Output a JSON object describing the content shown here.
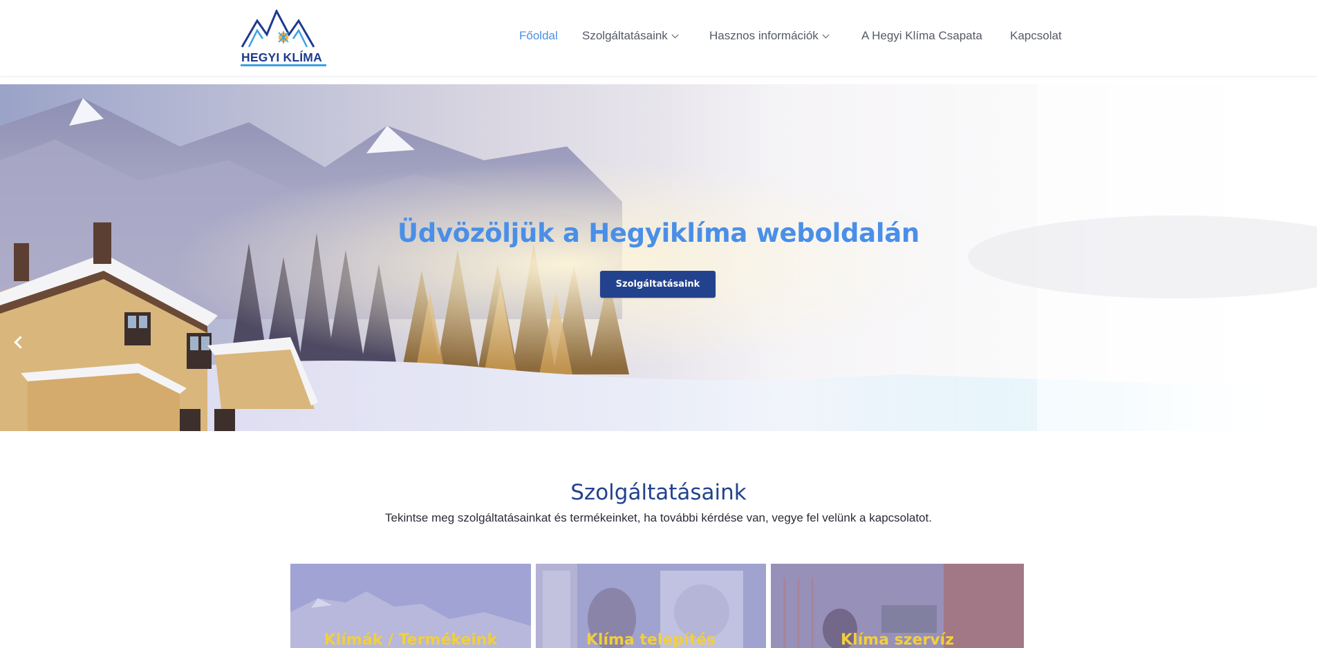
{
  "header": {
    "logo_text": "HEGYI KLÍMA",
    "nav": [
      {
        "label": "Főoldal",
        "active": true,
        "dropdown": false
      },
      {
        "label": "Szolgáltatásaink",
        "active": false,
        "dropdown": true
      },
      {
        "label": "Hasznos információk",
        "active": false,
        "dropdown": true
      },
      {
        "label": "A Hegyi Klíma Csapata",
        "active": false,
        "dropdown": false
      },
      {
        "label": "Kapcsolat",
        "active": false,
        "dropdown": false
      }
    ]
  },
  "hero": {
    "title": "Üdvözöljük a Hegyiklíma weboldalán",
    "button_label": "Szolgáltatásaink",
    "prev_icon": "chevron-left-icon",
    "next_icon": "chevron-right-icon"
  },
  "services": {
    "title": "Szolgáltatásaink",
    "subtitle": "Tekintse meg szolgáltatásainkat és termékeinket, ha további kérdése van, vegye fel velünk a kapcsolatot.",
    "cards": [
      {
        "label": "Klímák / Termékeink"
      },
      {
        "label": "Klíma telepítés"
      },
      {
        "label": "Klíma szervíz"
      }
    ]
  },
  "colors": {
    "accent": "#4a8fe7",
    "brand_dark": "#23428e",
    "card_label": "#f3cf3a"
  }
}
